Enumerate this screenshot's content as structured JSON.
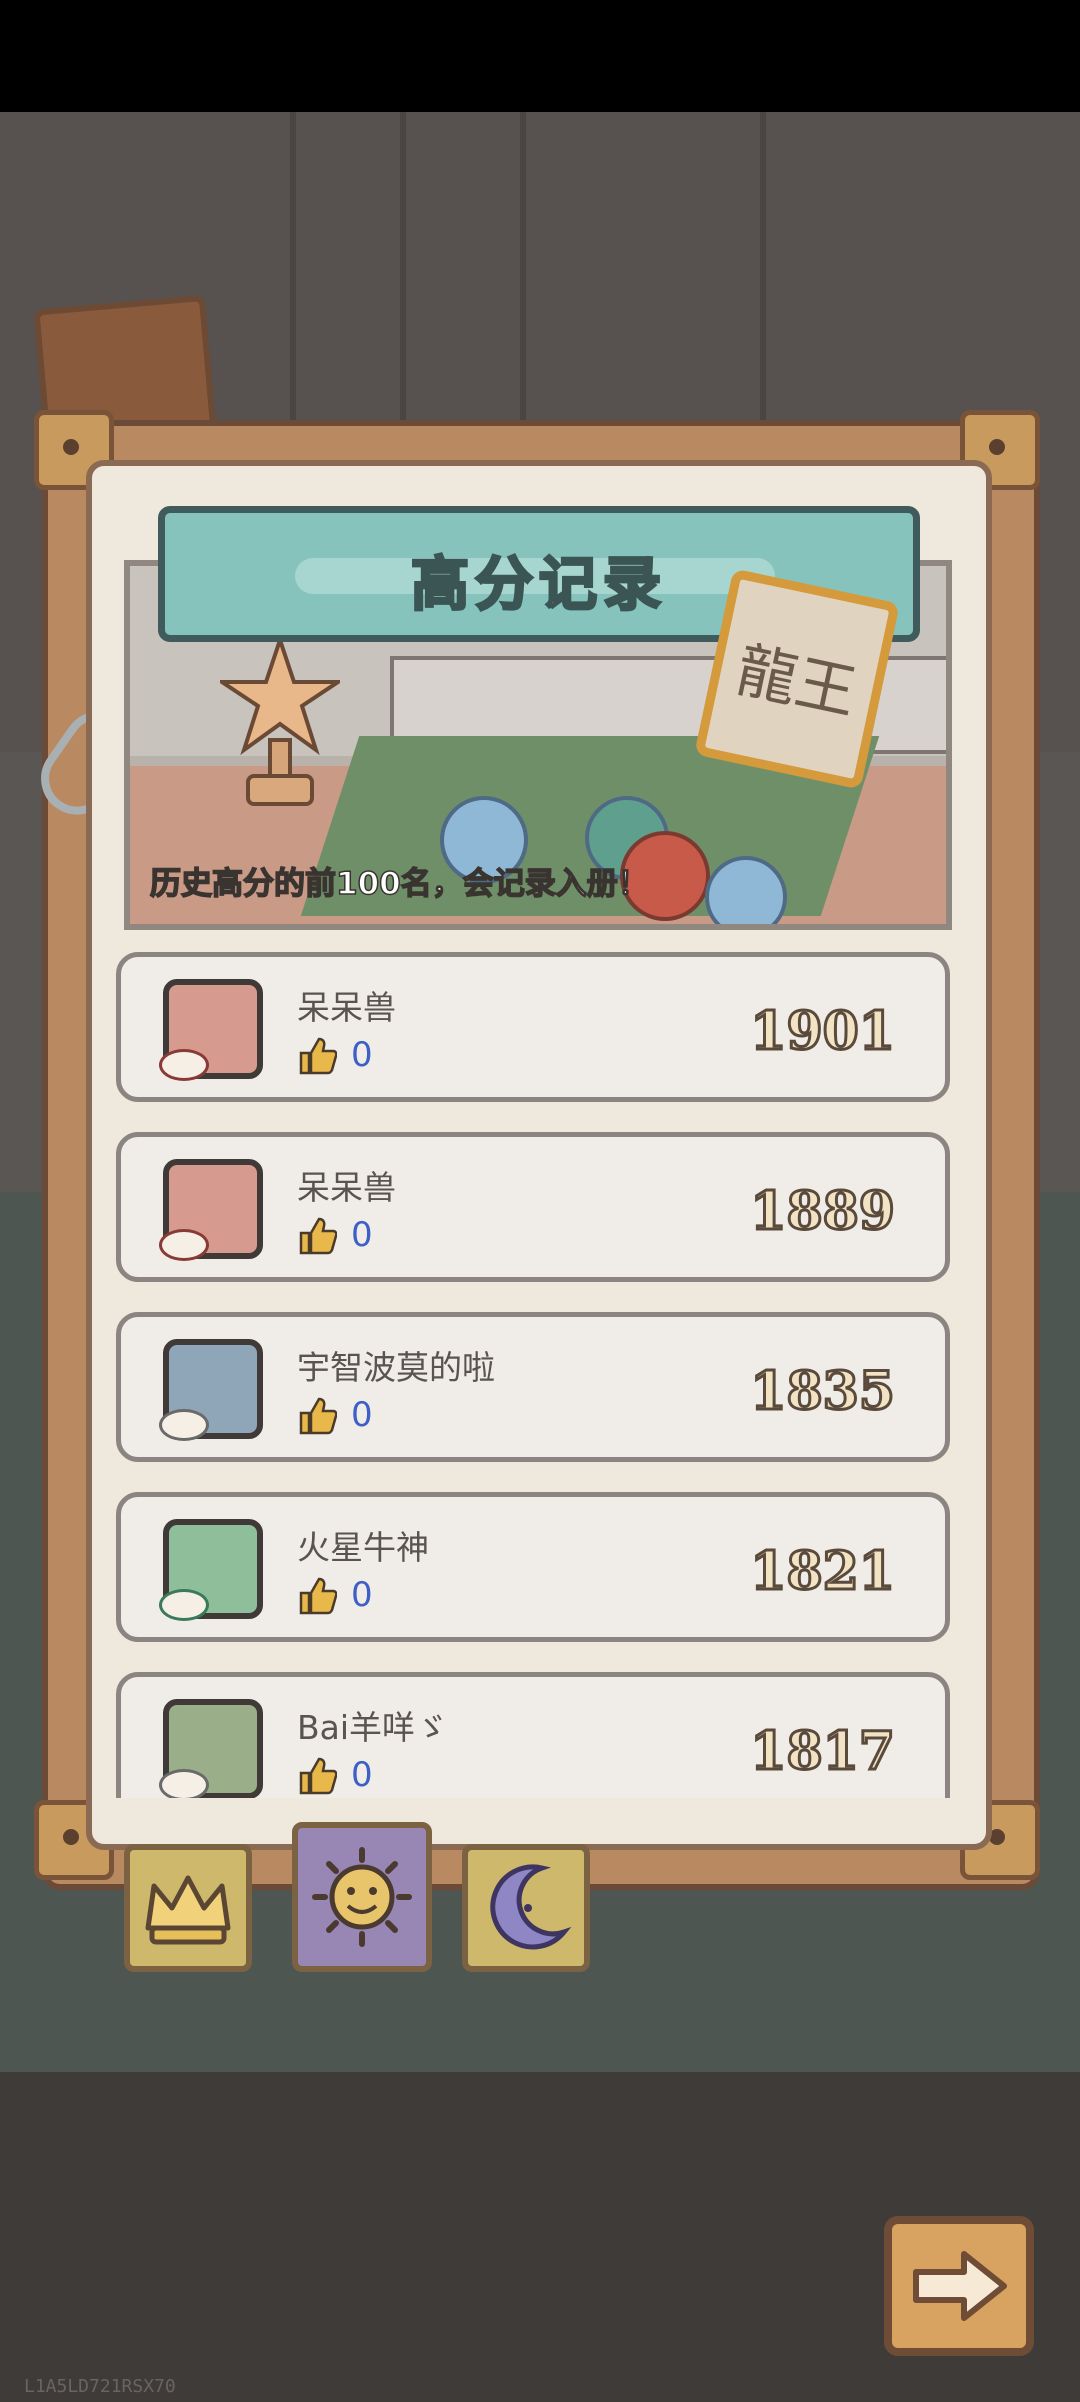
{
  "header": {
    "title": "高分记录",
    "subtitle": "历史高分的前100名，会记录入册！"
  },
  "badge_text": "龍王",
  "records": [
    {
      "name": "呆呆兽",
      "likes": "0",
      "score": "1901",
      "avatar_color": "#d69a8f"
    },
    {
      "name": "呆呆兽",
      "likes": "0",
      "score": "1889",
      "avatar_color": "#d69a8f"
    },
    {
      "name": "宇智波莫的啦",
      "likes": "0",
      "score": "1835",
      "avatar_color": "#8fa6b8"
    },
    {
      "name": "火星牛神",
      "likes": "0",
      "score": "1821",
      "avatar_color": "#8fbf9a"
    },
    {
      "name": "Bai羊咩ゞ",
      "likes": "0",
      "score": "1817",
      "avatar_color": "#9aae8a"
    }
  ],
  "tabs": [
    {
      "icon": "crown-icon",
      "active": false
    },
    {
      "icon": "sun-icon",
      "active": true
    },
    {
      "icon": "moon-icon",
      "active": false
    }
  ],
  "colors": {
    "accent": "#86c3bc",
    "like_count": "#3e5fc6",
    "frame": "#b98a62"
  },
  "watermark": "L1A5LD721RSX70"
}
